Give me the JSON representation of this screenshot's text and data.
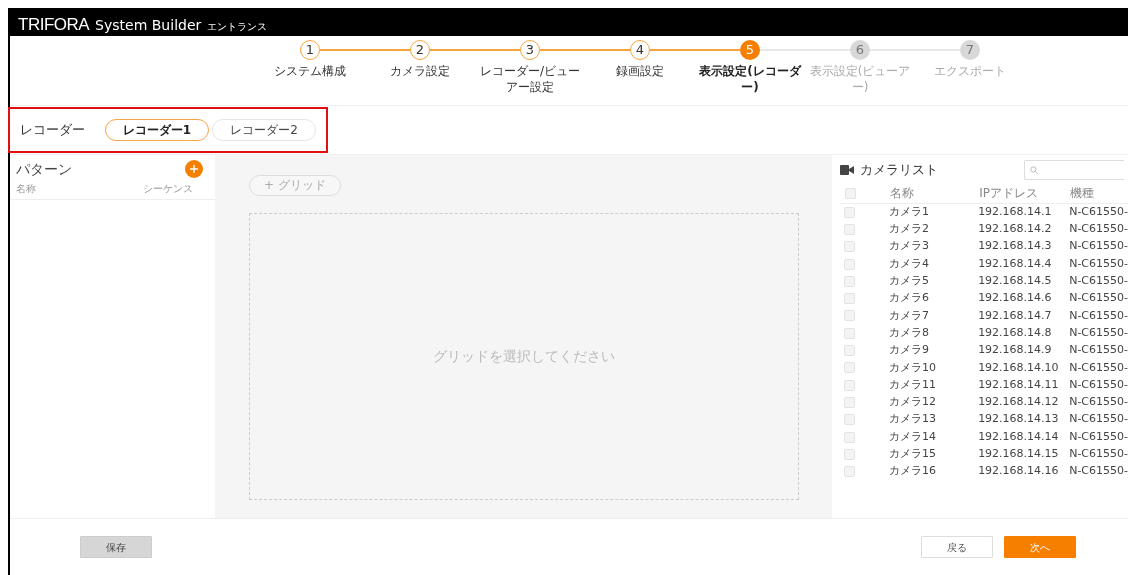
{
  "app_bar": {
    "brand": "TRIFORA",
    "product": "System Builder",
    "edition": "エントランス"
  },
  "steps": [
    {
      "number": "1",
      "label": "システム構成",
      "done": true,
      "selected": false
    },
    {
      "number": "2",
      "label": "カメラ設定",
      "done": true,
      "selected": false
    },
    {
      "number": "3",
      "label": "レコーダー/ビューアー設定",
      "done": true,
      "selected": false
    },
    {
      "number": "4",
      "label": "録画設定",
      "done": true,
      "selected": false
    },
    {
      "number": "5",
      "label": "表示設定(レコーダー)",
      "done": false,
      "selected": true
    },
    {
      "number": "6",
      "label": "表示設定(ビューアー)",
      "done": false,
      "selected": false
    },
    {
      "number": "7",
      "label": "エクスポート",
      "done": false,
      "selected": false
    }
  ],
  "recorder": {
    "label": "レコーダー",
    "tabs": [
      {
        "label": "レコーダー1",
        "selected": true
      },
      {
        "label": "レコーダー2",
        "selected": false
      }
    ]
  },
  "pattern_panel": {
    "title": "パターン",
    "columns": [
      "名称",
      "シーケンス"
    ]
  },
  "grid_area": {
    "add_button": "+ グリッド",
    "message": "グリッドを選択してください"
  },
  "camera_list": {
    "title": "カメラリスト",
    "select_all_checked": false,
    "columns": [
      "名称",
      "IPアドレス",
      "機種"
    ],
    "rows": [
      {
        "name": "カメラ1",
        "ip": "192.168.14.1",
        "model": "N-C61550-",
        "checked": false
      },
      {
        "name": "カメラ2",
        "ip": "192.168.14.2",
        "model": "N-C61550-",
        "checked": false
      },
      {
        "name": "カメラ3",
        "ip": "192.168.14.3",
        "model": "N-C61550-",
        "checked": false
      },
      {
        "name": "カメラ4",
        "ip": "192.168.14.4",
        "model": "N-C61550-",
        "checked": false
      },
      {
        "name": "カメラ5",
        "ip": "192.168.14.5",
        "model": "N-C61550-",
        "checked": false
      },
      {
        "name": "カメラ6",
        "ip": "192.168.14.6",
        "model": "N-C61550-",
        "checked": false
      },
      {
        "name": "カメラ7",
        "ip": "192.168.14.7",
        "model": "N-C61550-",
        "checked": false
      },
      {
        "name": "カメラ8",
        "ip": "192.168.14.8",
        "model": "N-C61550-",
        "checked": false
      },
      {
        "name": "カメラ9",
        "ip": "192.168.14.9",
        "model": "N-C61550-",
        "checked": false
      },
      {
        "name": "カメラ10",
        "ip": "192.168.14.10",
        "model": "N-C61550-",
        "checked": false
      },
      {
        "name": "カメラ11",
        "ip": "192.168.14.11",
        "model": "N-C61550-",
        "checked": false
      },
      {
        "name": "カメラ12",
        "ip": "192.168.14.12",
        "model": "N-C61550-",
        "checked": false
      },
      {
        "name": "カメラ13",
        "ip": "192.168.14.13",
        "model": "N-C61550-",
        "checked": false
      },
      {
        "name": "カメラ14",
        "ip": "192.168.14.14",
        "model": "N-C61550-",
        "checked": false
      },
      {
        "name": "カメラ15",
        "ip": "192.168.14.15",
        "model": "N-C61550-",
        "checked": false
      },
      {
        "name": "カメラ16",
        "ip": "192.168.14.16",
        "model": "N-C61550-",
        "checked": false
      }
    ]
  },
  "footer": {
    "save": "保存",
    "back": "戻る",
    "next": "次へ"
  }
}
